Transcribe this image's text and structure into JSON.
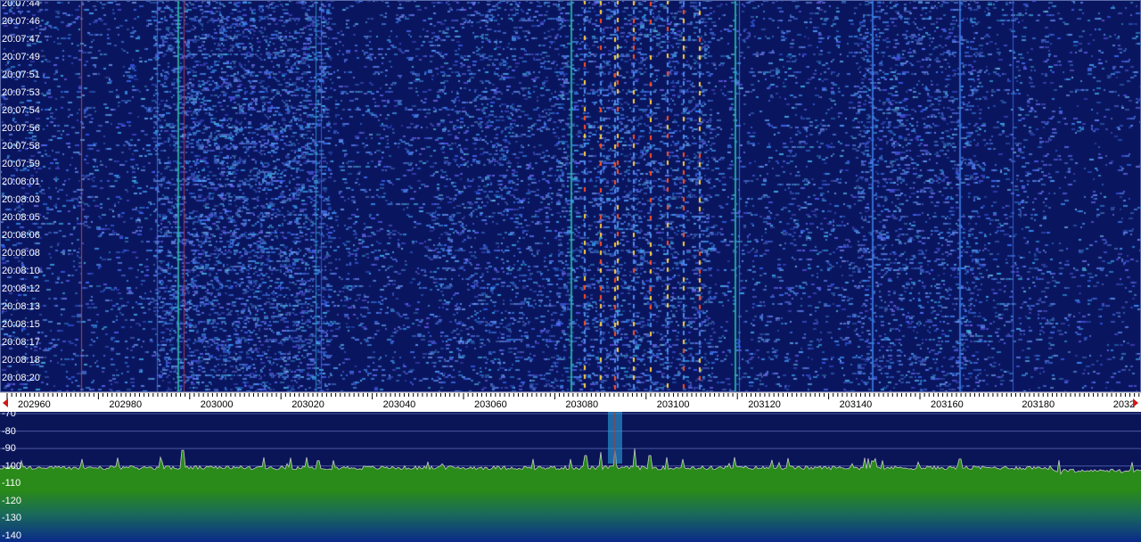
{
  "waterfall": {
    "timestamps": [
      "20:07:44",
      "20:07:46",
      "20:07:47",
      "20:07:49",
      "20:07:51",
      "20:07:53",
      "20:07:54",
      "20:07:56",
      "20:07:58",
      "20:07:59",
      "20:08:01",
      "20:08:03",
      "20:08:05",
      "20:08:06",
      "20:08:08",
      "20:08:10",
      "20:08:12",
      "20:08:13",
      "20:08:15",
      "20:08:17",
      "20:08:18",
      "20:08:20"
    ],
    "colors": {
      "background": "#0a1560",
      "signal_low": "#2a55d8",
      "signal_mid": "#1ec8a8",
      "signal_high": "#ffd040",
      "signal_peak": "#ff5020"
    }
  },
  "frequency_axis": {
    "labels": [
      "202960",
      "202980",
      "203000",
      "203020",
      "203040",
      "203060",
      "203080",
      "203100",
      "203120",
      "203140",
      "203160",
      "203180",
      "2032"
    ],
    "left_arrow_icon": "triangle-left-icon",
    "right_arrow_icon": "triangle-right-icon"
  },
  "spectrum": {
    "db_labels": [
      "-70",
      "-80",
      "-90",
      "-100",
      "-110",
      "-120",
      "-130",
      "-140"
    ],
    "noise_floor_db": -101,
    "colors": {
      "fill_top": "#2a8a1a",
      "fill_bottom": "#0a2a8a",
      "trace": "#c8c8c8",
      "grid": "#4a5aa0",
      "marker": "#2aa0d8",
      "marker_line": "#d03010"
    }
  }
}
